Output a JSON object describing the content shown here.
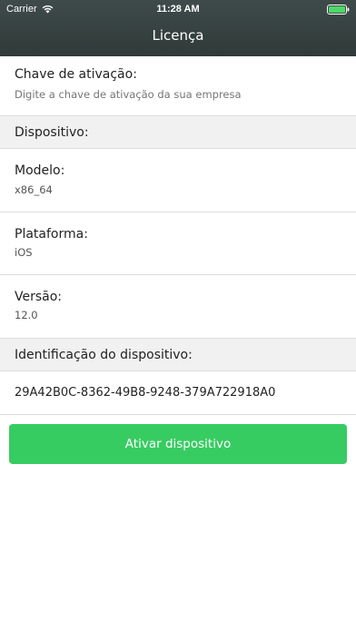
{
  "status_bar": {
    "carrier": "Carrier",
    "time": "11:28 AM"
  },
  "nav": {
    "title": "Licença"
  },
  "activation": {
    "label": "Chave de ativação:",
    "placeholder": "Digite a chave de ativação da sua empresa"
  },
  "device_section": {
    "header": "Dispositivo:"
  },
  "model": {
    "label": "Modelo:",
    "value": "x86_64"
  },
  "platform": {
    "label": "Plataforma:",
    "value": "iOS"
  },
  "version": {
    "label": "Versão:",
    "value": "12.0"
  },
  "device_id_section": {
    "header": "Identificação do dispositivo:",
    "value": "29A42B0C-8362-49B8-9248-379A722918A0"
  },
  "button": {
    "label": "Ativar dispositivo"
  },
  "colors": {
    "header_bg": "#34403f",
    "accent_green": "#37cc62",
    "section_gray": "#f1f1f1",
    "battery_green": "#4cd964"
  }
}
